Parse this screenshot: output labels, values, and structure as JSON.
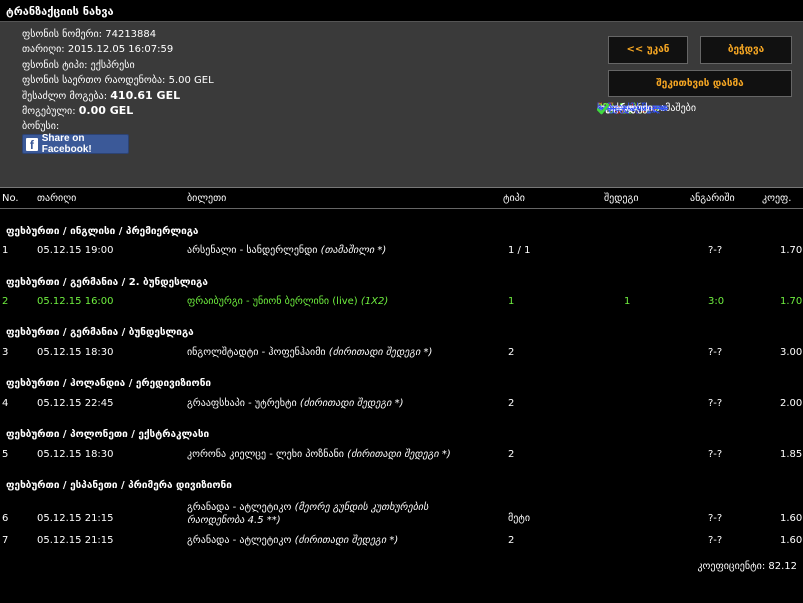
{
  "title": "ტრანზაქციის ნახვა",
  "info": [
    {
      "label": "ფსონის ნომერი:",
      "value": "74213884"
    },
    {
      "label": "თარიღი:",
      "value": "2015.12.05 16:07:59"
    },
    {
      "label": "ფსონის ტიპი:",
      "value": "ექსპრესი"
    },
    {
      "label": "ფსონის საერთო რაოდენობა:",
      "value": "5.00 GEL"
    },
    {
      "label": "შესაძლო მოგება:",
      "value": "410.61 GEL"
    },
    {
      "label": "მოგებული:",
      "value": "0.00 GEL"
    },
    {
      "label": "ბონუსი:",
      "value": ""
    }
  ],
  "facebook_label": "Share on Facebook!",
  "buttons": {
    "back": "<< უკან",
    "print": "ბეჭდვა",
    "change": "შეკითხვის დასმა"
  },
  "legend": {
    "win_bold": "მწვანე",
    "win_text": "= მოგებული",
    "lose_bold": "წითელი",
    "lose_text": "= წაგებული",
    "active_bold": "თეთრი",
    "active_text": "= აქტიური თამაშები",
    "calc_bold": "ხაზგადასმული",
    "calc_text": "= გაუქმებული",
    "odd_text": "= ლუქი"
  },
  "colors": {
    "win": "#6fef3f",
    "lose": "#e03030",
    "calc": "#3355ff",
    "accent": "#f5a623"
  },
  "columns": {
    "no": "No.",
    "date": "თარიღი",
    "event": "ბილეთი",
    "type": "ტიპი",
    "result": "შედეგი",
    "score": "ანგარიში",
    "odds": "კოეფ."
  },
  "rows": [
    {
      "group": "ფეხბურთი / ინგლისი / პრემიერლიგა",
      "no": "1",
      "date": "05.12.15 19:00",
      "event": "არსენალი - სანდერლენდი",
      "extra": "(თამაშილი *)",
      "type": "1 / 1",
      "result": "",
      "score": "?-?",
      "odds": "1.70",
      "status": "active"
    },
    {
      "group": "ფეხბურთი / გერმანია / 2. ბუნდესლიგა",
      "no": "2",
      "date": "05.12.15 16:00",
      "event": "ფრაიბურგი - უნიონ ბერლინი (live)",
      "extra": "(1X2)",
      "type": "1",
      "result": "1",
      "score": "3:0",
      "odds": "1.70",
      "status": "win"
    },
    {
      "group": "ფეხბურთი / გერმანია / ბუნდესლიგა",
      "no": "3",
      "date": "05.12.15 18:30",
      "event": "ინგოლშტადტი - ჰოფენჰაიმი",
      "extra": "(ძირითადი შედეგი *)",
      "type": "2",
      "result": "",
      "score": "?-?",
      "odds": "3.00",
      "status": "active"
    },
    {
      "group": "ფეხბურთი / ჰოლანდია / ერედივიზიონი",
      "no": "4",
      "date": "05.12.15 22:45",
      "event": "გრააფსხაპი - უტრეხტი",
      "extra": "(ძირითადი შედეგი *)",
      "type": "2",
      "result": "",
      "score": "?-?",
      "odds": "2.00",
      "status": "active"
    },
    {
      "group": "ფეხბურთი / პოლონეთი / ექსტრაკლასი",
      "no": "5",
      "date": "05.12.15 18:30",
      "event": "კორონა კიელცე - ლეხი პოზნანი",
      "extra": "(ძირითადი შედეგი *)",
      "type": "2",
      "result": "",
      "score": "?-?",
      "odds": "1.85",
      "status": "active"
    },
    {
      "group": "ფეხბურთი / ესპანეთი / პრიმერა დივიზიონი",
      "no": "6",
      "date": "05.12.15 21:15",
      "event": "გრანადა - ატლეტიკო",
      "extra": "(მეორე გუნდის კუთხურების რაოდენობა 4.5 **)",
      "type": "მეტი",
      "result": "",
      "score": "?-?",
      "odds": "1.60",
      "status": "active"
    },
    {
      "group": "",
      "no": "7",
      "date": "05.12.15 21:15",
      "event": "გრანადა - ატლეტიკო",
      "extra": "(ძირითადი შედეგი *)",
      "type": "2",
      "result": "",
      "score": "?-?",
      "odds": "1.60",
      "status": "active"
    }
  ],
  "total_label": "კოეფიციენტი: 82.12"
}
